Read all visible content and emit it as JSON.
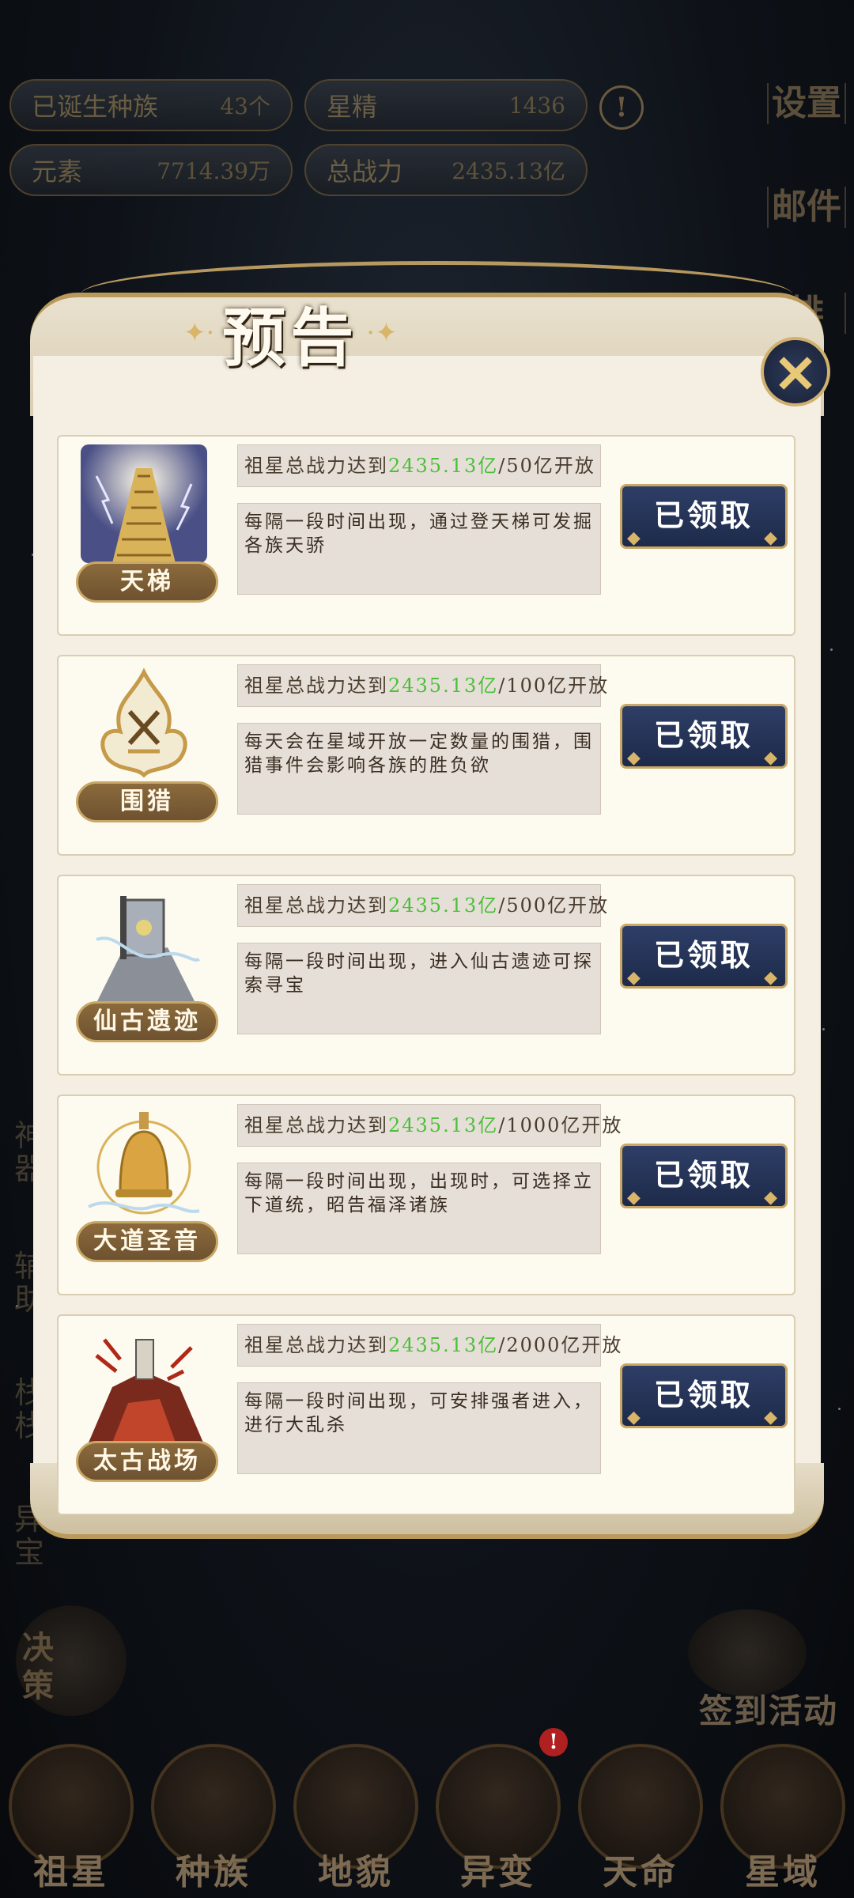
{
  "top_stats": {
    "born_races": {
      "label": "已诞生种族",
      "value": "43个"
    },
    "star_essence": {
      "label": "星精",
      "value": "1436"
    },
    "elements": {
      "label": "元素",
      "value": "7714.39万"
    },
    "total_power": {
      "label": "总战力",
      "value": "2435.13亿"
    },
    "warning_glyph": "!"
  },
  "side_menu": {
    "settings": "设置",
    "mail": "邮件",
    "rank": "排"
  },
  "left_side_dim": [
    "神器",
    "辅助",
    "栈栈",
    "异宝"
  ],
  "dialog": {
    "title": "预告",
    "close_glyph": "✕",
    "items": [
      {
        "name": "天梯",
        "cond_prefix": "祖星总战力达到",
        "cond_current": "2435.13亿",
        "cond_suffix": "/50亿开放",
        "desc": "每隔一段时间出现，通过登天梯可发掘各族天骄",
        "button": "已领取"
      },
      {
        "name": "围猎",
        "cond_prefix": "祖星总战力达到",
        "cond_current": "2435.13亿",
        "cond_suffix": "/100亿开放",
        "desc": "每天会在星域开放一定数量的围猎，围猎事件会影响各族的胜负欲",
        "button": "已领取"
      },
      {
        "name": "仙古遗迹",
        "cond_prefix": "祖星总战力达到",
        "cond_current": "2435.13亿",
        "cond_suffix": "/500亿开放",
        "desc": "每隔一段时间出现，进入仙古遗迹可探索寻宝",
        "button": "已领取"
      },
      {
        "name": "大道圣音",
        "cond_prefix": "祖星总战力达到",
        "cond_current": "2435.13亿",
        "cond_suffix": "/1000亿开放",
        "desc": "每隔一段时间出现，出现时，可选择立下道统，昭告福泽诸族",
        "button": "已领取"
      },
      {
        "name": "太古战场",
        "cond_prefix": "祖星总战力达到",
        "cond_current": "2435.13亿",
        "cond_suffix": "/2000亿开放",
        "desc": "每隔一段时间出现，可安排强者进入，进行大乱杀",
        "button": "已领取"
      }
    ]
  },
  "decision_label": "决策",
  "checkin_label": "签到活动",
  "bottom_nav": [
    "祖星",
    "种族",
    "地貌",
    "异变",
    "天命",
    "星域"
  ],
  "badge_glyph": "!",
  "colors": {
    "highlight_green": "#4cbf3a",
    "button_navy": "#2e3e66",
    "gold": "#c9a766"
  }
}
